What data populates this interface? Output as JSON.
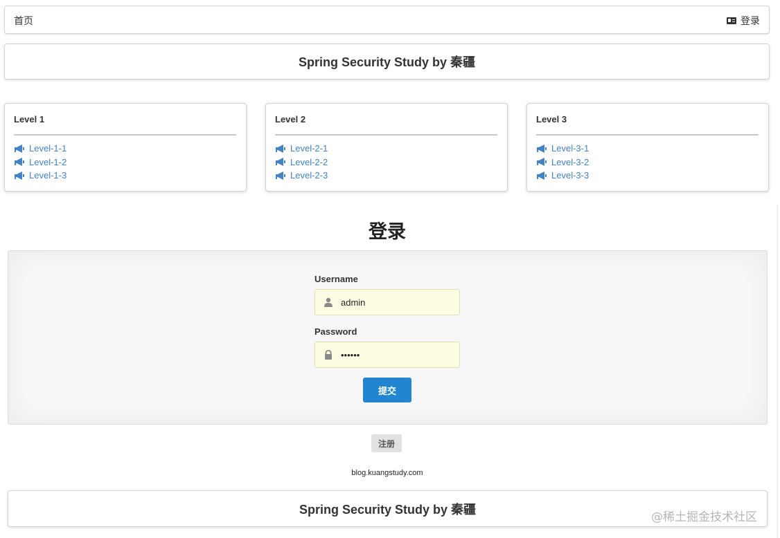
{
  "nav": {
    "home_label": "首页",
    "login_label": "登录"
  },
  "header": {
    "title": "Spring Security Study by 秦疆"
  },
  "levels": [
    {
      "title": "Level 1",
      "items": [
        "Level-1-1",
        "Level-1-2",
        "Level-1-3"
      ]
    },
    {
      "title": "Level 2",
      "items": [
        "Level-2-1",
        "Level-2-2",
        "Level-2-3"
      ]
    },
    {
      "title": "Level 3",
      "items": [
        "Level-3-1",
        "Level-3-2",
        "Level-3-3"
      ]
    }
  ],
  "login": {
    "heading": "登录",
    "username_label": "Username",
    "username_value": "admin",
    "password_label": "Password",
    "password_value": "••••••",
    "submit_label": "提交",
    "register_label": "注册"
  },
  "footer": {
    "site": "blog.kuangstudy.com",
    "title": "Spring Security Study by 秦疆"
  },
  "watermark": "@稀土掘金技术社区",
  "colors": {
    "link": "#4183c4",
    "primary_button": "#2185d0",
    "input_fill": "#fdfde3"
  },
  "icons": {
    "nav_login": "id-card-icon",
    "level_item": "bullhorn-icon",
    "username": "user-icon",
    "password": "lock-icon"
  }
}
